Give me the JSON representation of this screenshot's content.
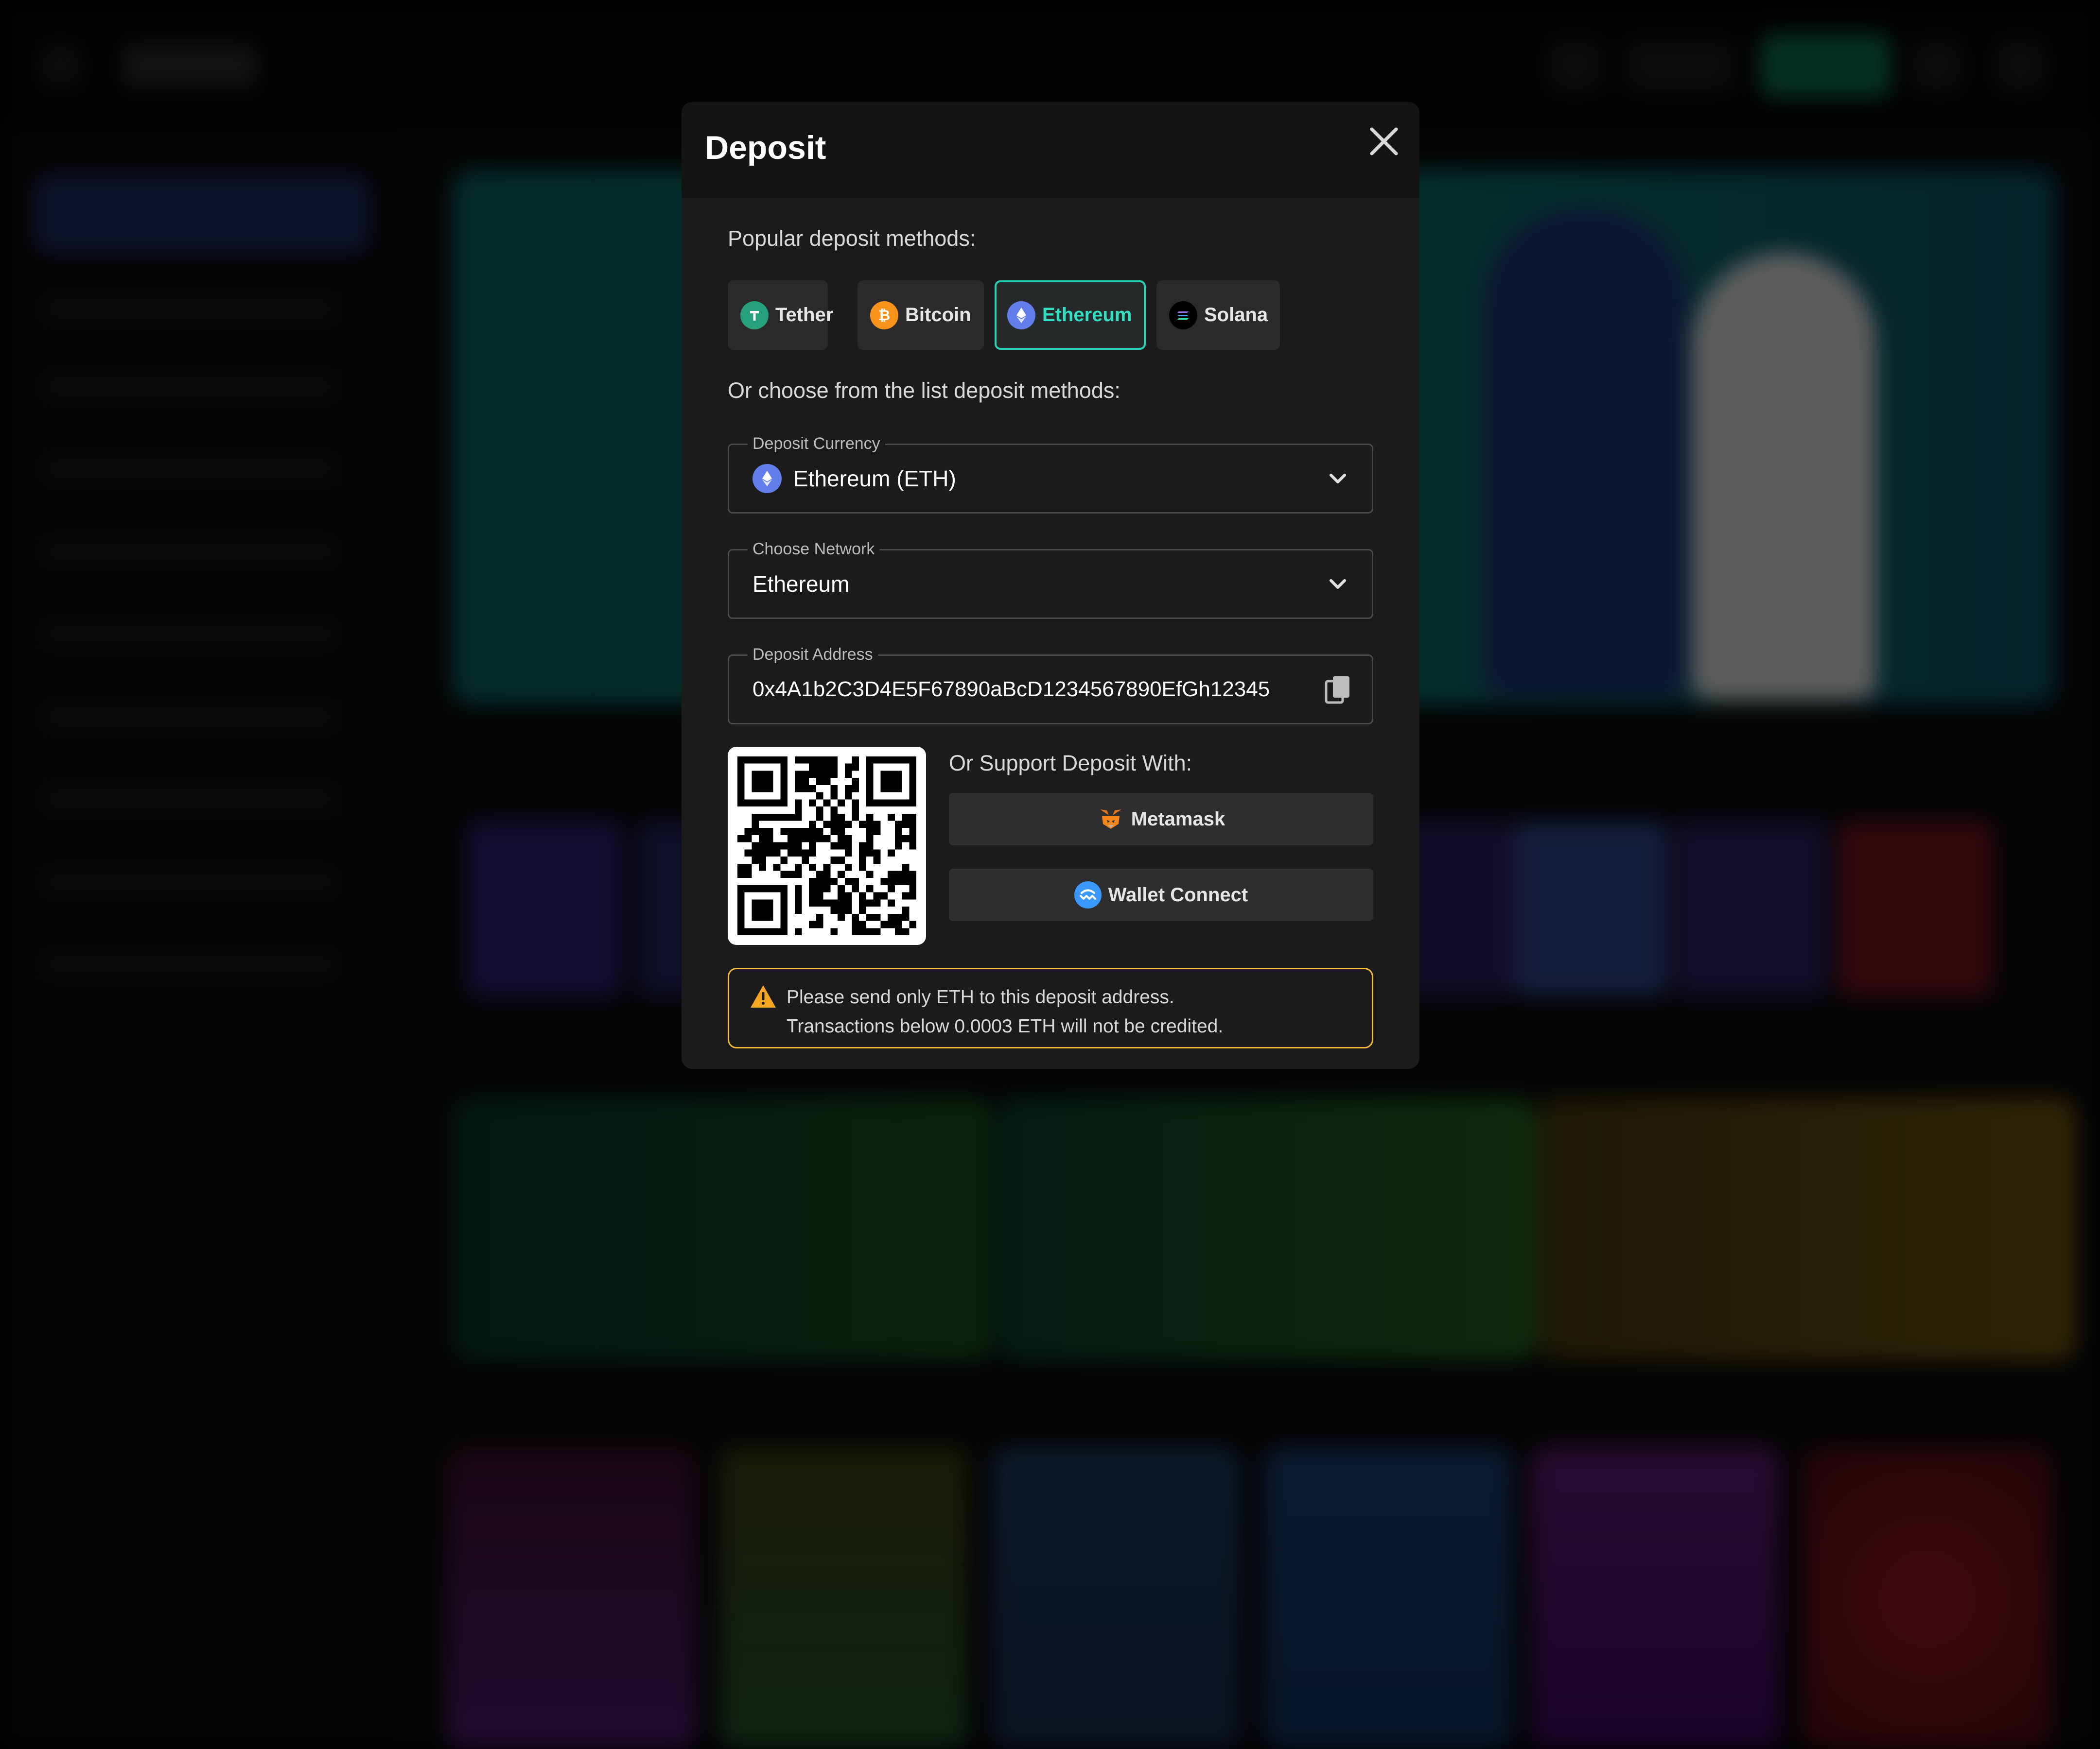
{
  "modal": {
    "title": "Deposit",
    "popular_label": "Popular deposit methods:",
    "methods": [
      {
        "label": "Tether",
        "icon": "tether-icon",
        "color": "#26a17b"
      },
      {
        "label": "Bitcoin",
        "icon": "bitcoin-icon",
        "color": "#f7931a"
      },
      {
        "label": "Ethereum",
        "icon": "ethereum-icon",
        "color": "#627eea",
        "selected": true
      },
      {
        "label": "Solana",
        "icon": "solana-icon",
        "color": "#000000"
      }
    ],
    "list_label": "Or choose from the list deposit methods:",
    "currency": {
      "legend": "Deposit Currency",
      "value": "Ethereum (ETH)",
      "icon": "ethereum-icon"
    },
    "network": {
      "legend": "Choose Network",
      "value": "Ethereum"
    },
    "address": {
      "legend": "Deposit Address",
      "value": "0x4A1b2C3D4E5F67890aBcD1234567890EfGh12345"
    },
    "support_label": "Or Support Deposit With:",
    "wallets": [
      {
        "label": "Metamask",
        "icon": "metamask-fox-icon"
      },
      {
        "label": "Wallet Connect",
        "icon": "walletconnect-icon"
      }
    ],
    "warning": {
      "line1": "Please send only ETH to this deposit address.",
      "line2": "Transactions below 0.0003 ETH will not be credited."
    }
  },
  "colors": {
    "accent": "#29d1b4",
    "warning": "#f0b93a",
    "modal_bg": "#1b1b1c",
    "header_bg": "#141415"
  }
}
